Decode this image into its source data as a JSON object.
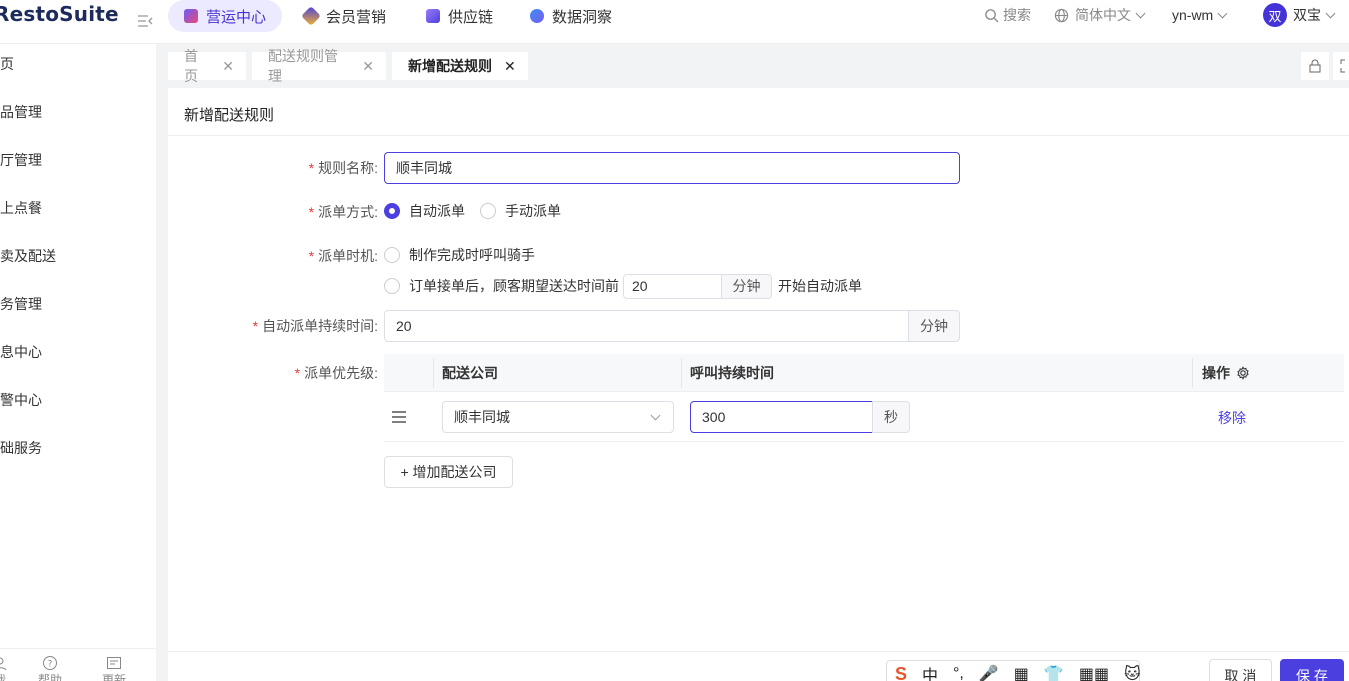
{
  "app": {
    "logo": "RestoSuite"
  },
  "topnav": {
    "items": [
      {
        "label": "营运中心",
        "active": true,
        "icon": "operations-icon",
        "color": "#4b3fe0"
      },
      {
        "label": "会员营销",
        "active": false,
        "icon": "member-icon",
        "color": "#4b3fe0"
      },
      {
        "label": "供应链",
        "active": false,
        "icon": "supply-chain-icon",
        "color": "#7a5cf0"
      },
      {
        "label": "数据洞察",
        "active": false,
        "icon": "data-insight-icon",
        "color": "#3a8ef6"
      }
    ],
    "search": "搜索",
    "language": "简体中文",
    "store": "yn-wm",
    "avatar_text": "双",
    "user_name": "双宝"
  },
  "sidebar": {
    "items": [
      "首页",
      "商品管理",
      "餐厅管理",
      "线上点餐",
      "外卖及配送",
      "财务管理",
      "消息中心",
      "预警中心",
      "基础服务"
    ],
    "bottom": [
      {
        "label": "我",
        "icon": "user-icon"
      },
      {
        "label": "帮助",
        "icon": "help-icon"
      },
      {
        "label": "更新",
        "icon": "update-icon"
      }
    ]
  },
  "tabs": [
    {
      "label": "首页",
      "active": false
    },
    {
      "label": "配送规则管理",
      "active": false
    },
    {
      "label": "新增配送规则",
      "active": true
    }
  ],
  "form": {
    "title": "新增配送规则",
    "rule_name": {
      "label": "规则名称:",
      "value": "顺丰同城"
    },
    "dispatch_mode": {
      "label": "派单方式:",
      "options": [
        "自动派单",
        "手动派单"
      ],
      "selected": "自动派单"
    },
    "dispatch_timing": {
      "label": "派单时机:",
      "option1": "制作完成时呼叫骑手",
      "option2_prefix": "订单接单后，顾客期望送达时间前",
      "option2_value": "20",
      "option2_unit": "分钟",
      "option2_suffix": "开始自动派单"
    },
    "auto_duration": {
      "label": "自动派单持续时间:",
      "value": "20",
      "unit": "分钟"
    },
    "priority": {
      "label": "派单优先级:",
      "columns": [
        "配送公司",
        "呼叫持续时间",
        "操作"
      ],
      "rows": [
        {
          "company": "顺丰同城",
          "duration": "300",
          "unit": "秒",
          "action": "移除"
        }
      ],
      "add_label": "+ 增加配送公司"
    }
  },
  "footer": {
    "cancel": "取 消",
    "save": "保 存"
  },
  "ime": [
    "中",
    "°,",
    "🎤",
    "▦",
    "👕",
    "▦▦",
    "🐱"
  ]
}
